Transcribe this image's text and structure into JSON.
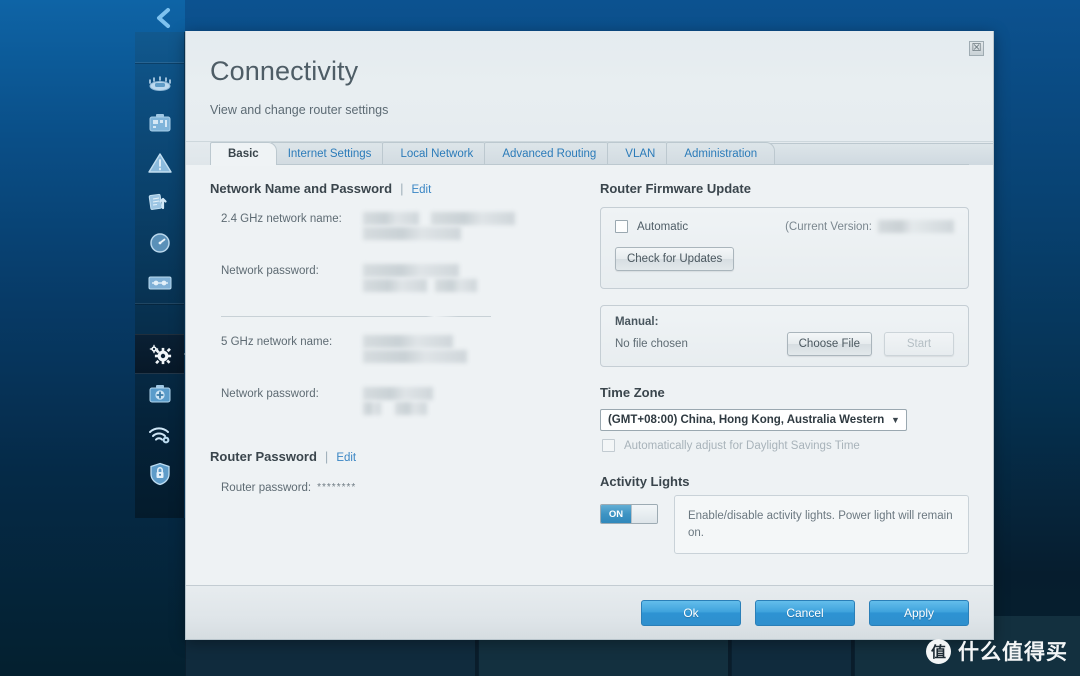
{
  "window": {
    "back_arrow_icon": "chevron-left-icon",
    "close_label": "☒"
  },
  "sidebar": {
    "groups": [
      {
        "items": [
          {
            "icon": "router-device-icon",
            "name": "sidebar-item-device",
            "active": false
          },
          {
            "icon": "troubleshoot-toolbox-icon",
            "name": "sidebar-item-troubleshooting",
            "active": false
          },
          {
            "icon": "warning-triangle-icon",
            "name": "sidebar-item-alerts",
            "active": false
          },
          {
            "icon": "transfer-refresh-icon",
            "name": "sidebar-item-transfer",
            "active": false
          },
          {
            "icon": "speed-gauge-icon",
            "name": "sidebar-item-speed",
            "active": false
          },
          {
            "icon": "media-bar-icon",
            "name": "sidebar-item-media",
            "active": false
          }
        ]
      },
      {
        "items": [
          {
            "icon": "gears-icon",
            "name": "sidebar-item-connectivity",
            "active": true
          },
          {
            "icon": "medical-kit-icon",
            "name": "sidebar-item-troubleshooting-2",
            "active": false
          },
          {
            "icon": "wifi-settings-icon",
            "name": "sidebar-item-wifi-settings",
            "active": false
          },
          {
            "icon": "shield-lock-icon",
            "name": "sidebar-item-security",
            "active": false
          }
        ]
      }
    ]
  },
  "dialog": {
    "title": "Connectivity",
    "subtitle": "View and change router settings",
    "tabs": [
      {
        "label": "Basic",
        "active": true
      },
      {
        "label": "Internet Settings",
        "active": false
      },
      {
        "label": "Local Network",
        "active": false
      },
      {
        "label": "Advanced Routing",
        "active": false
      },
      {
        "label": "VLAN",
        "active": false
      },
      {
        "label": "Administration",
        "active": false
      }
    ],
    "left": {
      "network_section": {
        "heading": "Network Name and Password",
        "separator": "|",
        "edit_label": "Edit",
        "fields": [
          {
            "label": "2.4 GHz network name:",
            "value": "",
            "redacted": true
          },
          {
            "label": "Network password:",
            "value": "",
            "redacted": true
          },
          {
            "label": "5 GHz network name:",
            "value": "",
            "redacted": true
          },
          {
            "label": "Network password:",
            "value": "",
            "redacted": true
          }
        ]
      },
      "router_password_section": {
        "heading": "Router Password",
        "separator": "|",
        "edit_label": "Edit",
        "field_label": "Router password:",
        "field_value": "********"
      }
    },
    "right": {
      "firmware": {
        "heading": "Router Firmware Update",
        "automatic_label": "Automatic",
        "automatic_checked": false,
        "current_version_label": "(Current Version:",
        "current_version_value": "",
        "check_updates_label": "Check for Updates",
        "manual_label": "Manual:",
        "file_status": "No file chosen",
        "choose_file_label": "Choose File",
        "start_label": "Start",
        "start_disabled": true
      },
      "time_zone": {
        "heading": "Time Zone",
        "selected": "(GMT+08:00) China, Hong Kong, Australia Western",
        "dropdown_icon": "chevron-down-icon",
        "dst_label": "Automatically adjust for Daylight Savings Time",
        "dst_checked": false
      },
      "activity_lights": {
        "heading": "Activity Lights",
        "toggle_state": "ON",
        "hint": "Enable/disable activity lights. Power light will remain on."
      }
    },
    "footer": {
      "ok_label": "Ok",
      "cancel_label": "Cancel",
      "apply_label": "Apply"
    }
  },
  "watermark": {
    "logo_char": "值",
    "text": "什么值得买"
  },
  "colors": {
    "accent_blue": "#2f8fcd",
    "tab_link": "#2b7bb9",
    "dialog_bg": "#eef2f4"
  }
}
